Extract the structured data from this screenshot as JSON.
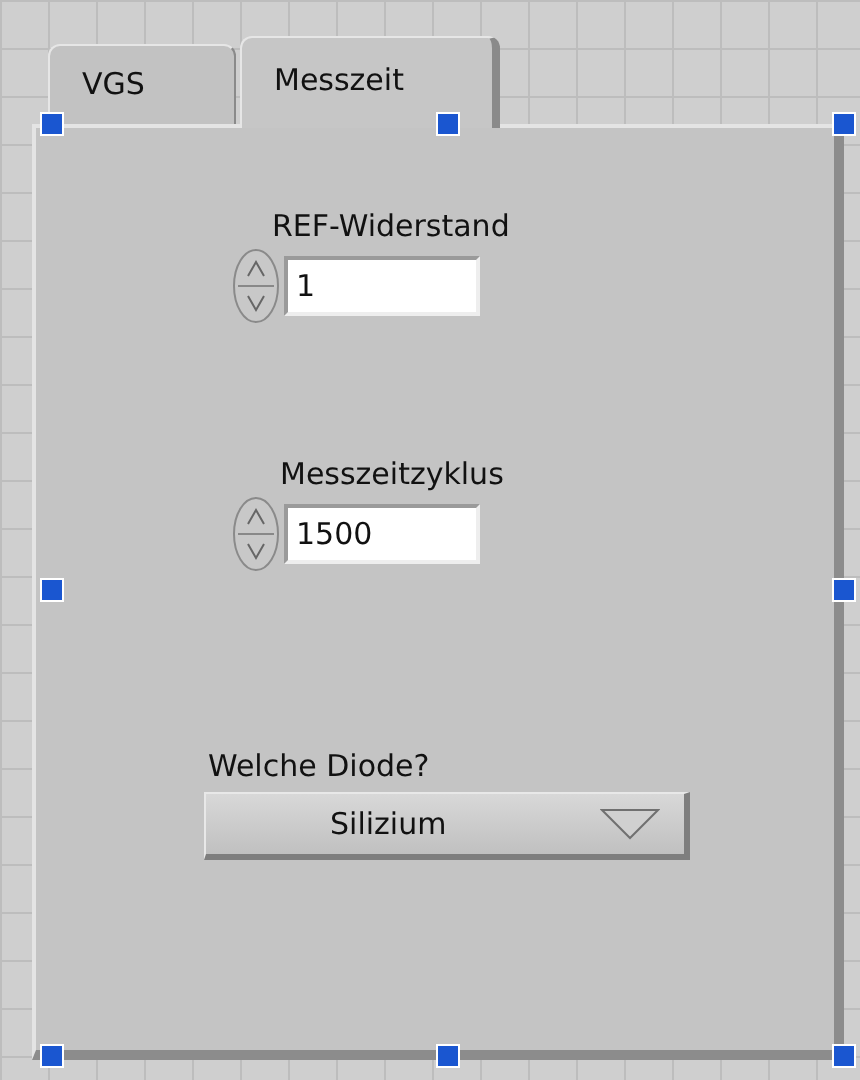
{
  "tab_control": {
    "edit_selected": true,
    "tabs": [
      {
        "label": "VGS",
        "selected": false
      },
      {
        "label": "Messzeit",
        "selected": true
      }
    ],
    "controls": [
      {
        "kind": "numeric",
        "label": "REF-Widerstand",
        "value": "1"
      },
      {
        "kind": "numeric",
        "label": "Messzeitzyklus",
        "value": "1500"
      },
      {
        "kind": "ring",
        "label": "Welche Diode?",
        "value": "Silizium"
      }
    ]
  }
}
